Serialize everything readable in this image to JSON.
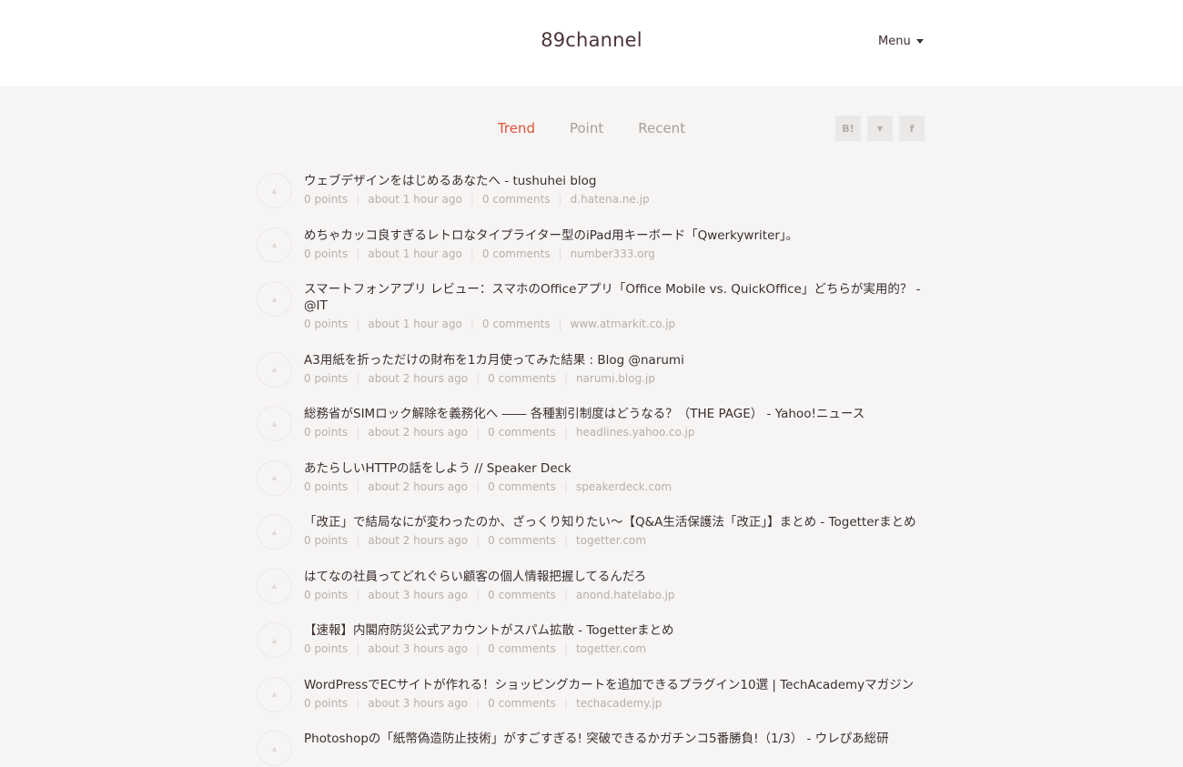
{
  "header": {
    "logo": "89channel",
    "menu_label": "Menu"
  },
  "tabs": [
    {
      "label": "Trend",
      "active": true
    },
    {
      "label": "Point"
    },
    {
      "label": "Recent"
    }
  ],
  "social": [
    {
      "label": "B!",
      "icon": "hatena-bookmark-icon"
    },
    {
      "label": "▼",
      "icon": "twitter-icon"
    },
    {
      "label": "f",
      "icon": "facebook-icon"
    }
  ],
  "accent_color": "#e0533a",
  "items": [
    {
      "title": "ウェブデザインをはじめるあなたへ - tushuhei blog",
      "points": "0 points",
      "time": "about 1 hour ago",
      "comments": "0 comments",
      "domain": "d.hatena.ne.jp"
    },
    {
      "title": "めちゃカッコ良すぎるレトロなタイプライター型のiPad用キーボード「Qwerkywriter」。",
      "points": "0 points",
      "time": "about 1 hour ago",
      "comments": "0 comments",
      "domain": "number333.org"
    },
    {
      "title": "スマートフォンアプリ レビュー：スマホのOfficeアプリ「Office Mobile vs. QuickOffice」どちらが実用的？ - @IT",
      "points": "0 points",
      "time": "about 1 hour ago",
      "comments": "0 comments",
      "domain": "www.atmarkit.co.jp"
    },
    {
      "title": "A3用紙を折っただけの財布を1カ月使ってみた結果 : Blog @narumi",
      "points": "0 points",
      "time": "about 2 hours ago",
      "comments": "0 comments",
      "domain": "narumi.blog.jp"
    },
    {
      "title": "総務省がSIMロック解除を義務化へ ―― 各種割引制度はどうなる？（THE PAGE） - Yahoo!ニュース",
      "points": "0 points",
      "time": "about 2 hours ago",
      "comments": "0 comments",
      "domain": "headlines.yahoo.co.jp"
    },
    {
      "title": "あたらしいHTTPの話をしよう // Speaker Deck",
      "points": "0 points",
      "time": "about 2 hours ago",
      "comments": "0 comments",
      "domain": "speakerdeck.com"
    },
    {
      "title": "「改正」で結局なにが変わったのか、ざっくり知りたい～【Q&A生活保護法「改正」】まとめ - Togetterまとめ",
      "points": "0 points",
      "time": "about 2 hours ago",
      "comments": "0 comments",
      "domain": "togetter.com"
    },
    {
      "title": "はてなの社員ってどれぐらい顧客の個人情報把握してるんだろ",
      "points": "0 points",
      "time": "about 3 hours ago",
      "comments": "0 comments",
      "domain": "anond.hatelabo.jp"
    },
    {
      "title": "【速報】内閣府防災公式アカウントがスパム拡散 - Togetterまとめ",
      "points": "0 points",
      "time": "about 3 hours ago",
      "comments": "0 comments",
      "domain": "togetter.com"
    },
    {
      "title": "WordPressでECサイトが作れる！ショッピングカートを追加できるプラグイン10選 | TechAcademyマガジン",
      "points": "0 points",
      "time": "about 3 hours ago",
      "comments": "0 comments",
      "domain": "techacademy.jp"
    },
    {
      "title": "Photoshopの「紙幣偽造防止技術」がすごすぎる! 突破できるかガチンコ5番勝負!（1/3） - ウレぴあ総研"
    }
  ]
}
